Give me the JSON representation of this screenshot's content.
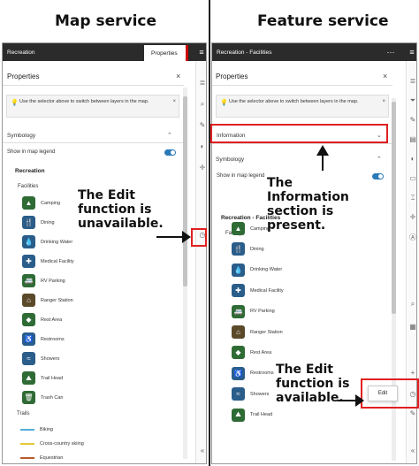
{
  "headings": {
    "left": "Map service",
    "right": "Feature service"
  },
  "left": {
    "topbar_title": "Recreation",
    "tab_label": "Properties",
    "panel_title": "Properties",
    "info_text": "Use the selector above to switch between layers in the map.",
    "symbology_label": "Symbology",
    "show_legend_label": "Show in map legend",
    "layer_name": "Recreation",
    "group_label": "Facilities",
    "legend": [
      "Camping",
      "Dining",
      "Drinking Water",
      "Medical Facility",
      "RV Parking",
      "Ranger Station",
      "Rest Area",
      "Restrooms",
      "Showers",
      "Trail Head",
      "Trash Can"
    ],
    "trails_label": "Trails",
    "trails": [
      "Biking",
      "Cross-country skiing",
      "Equestrian"
    ],
    "annotation": "The Edit function is unavailable."
  },
  "right": {
    "topbar_title": "Recreation - Facilities",
    "panel_title": "Properties",
    "info_text": "Use the selector above to switch between layers in the map.",
    "information_label": "Information",
    "symbology_label": "Symbology",
    "show_legend_label": "Show in map legend",
    "layer_name": "Recreation - Facilities",
    "group_label": "Facility",
    "legend": [
      "Camping",
      "Dining",
      "Drinking Water",
      "Medical Facility",
      "RV Parking",
      "Ranger Station",
      "Rest Area",
      "Restrooms",
      "Showers",
      "Trail Head"
    ],
    "annotation_info": "The Information section is present.",
    "annotation_edit": "The Edit function is available.",
    "edit_button": "Edit"
  },
  "colors": {
    "accent": "#2a7ab8",
    "annotation_red": "#e02020",
    "topbar": "#2b2b2b",
    "symbol_green": "#2f6b35"
  },
  "icons": [
    "settings-sliders-icon",
    "close-icon",
    "lightbulb-icon",
    "chevron-up-icon",
    "chevron-down-icon",
    "search-icon",
    "filter-icon",
    "pencil-icon",
    "plus-icon",
    "edit-icon"
  ]
}
